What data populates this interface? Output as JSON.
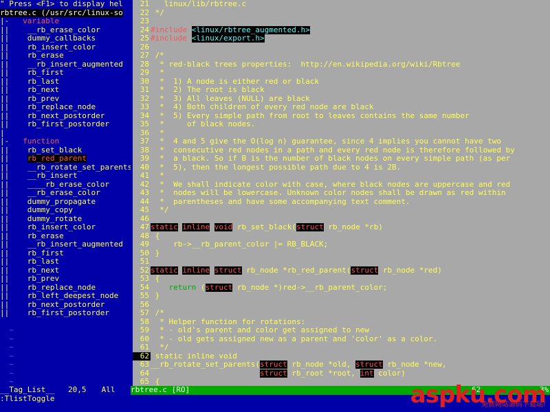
{
  "taglist": {
    "help_line": "\" Press <F1> to display hel",
    "file_header": "rbtree.c (/usr/src/linux-so",
    "groups": [
      {
        "marker": "|-",
        "title": "variable",
        "items": [
          "__rb_erase_color",
          "dummy_callbacks",
          "rb_insert_color",
          "rb_erase",
          "__rb_insert_augmented",
          "rb_first",
          "rb_last",
          "rb_next",
          "rb_prev",
          "rb_replace_node",
          "rb_next_postorder",
          "rb_first_postorder"
        ]
      },
      {
        "marker": "|-",
        "title": "function",
        "items": [
          "rb_set_black",
          "rb_red_parent",
          "__rb_rotate_set_parents",
          "__rb_insert",
          "____rb_erase_color",
          "__rb_erase_color",
          "dummy_propagate",
          "dummy_copy",
          "dummy_rotate",
          "rb_insert_color",
          "rb_erase",
          "__rb_insert_augmented",
          "rb_first",
          "rb_last",
          "rb_next",
          "rb_prev",
          "rb_replace_node",
          "rb_left_deepest_node",
          "rb_next_postorder",
          "rb_first_postorder"
        ]
      }
    ],
    "selected_item": "rb_red_parent",
    "tree_pipe": "||",
    "tilde": "~"
  },
  "editor": {
    "lines": [
      {
        "n": "21",
        "t": "  linux/lib/rbtree.c"
      },
      {
        "n": "22",
        "t": "*/"
      },
      {
        "n": "23",
        "t": ""
      },
      {
        "n": "24",
        "pp": "#include",
        "inc": "<linux/rbtree_augmented.h>"
      },
      {
        "n": "25",
        "pp": "#include",
        "inc": "<linux/export.h>"
      },
      {
        "n": "26",
        "t": ""
      },
      {
        "n": "27",
        "t": "/*"
      },
      {
        "n": "28",
        "t": " * red-black trees properties:  http://en.wikipedia.org/wiki/Rbtree"
      },
      {
        "n": "29",
        "t": " *"
      },
      {
        "n": "30",
        "t": " *  1) A node is either red or black"
      },
      {
        "n": "31",
        "t": " *  2) The root is black"
      },
      {
        "n": "32",
        "t": " *  3) All leaves (NULL) are black"
      },
      {
        "n": "33",
        "t": " *  4) Both children of every red node are black"
      },
      {
        "n": "34",
        "t": " *  5) Every simple path from root to leaves contains the same number"
      },
      {
        "n": "35",
        "t": " *     of black nodes."
      },
      {
        "n": "36",
        "t": " *"
      },
      {
        "n": "37",
        "t": " *  4 and 5 give the O(log n) guarantee, since 4 implies you cannot have two"
      },
      {
        "n": "38",
        "t": " *  consecutive red nodes in a path and every red node is therefore followed by"
      },
      {
        "n": "39",
        "t": " *  a black. So if B is the number of black nodes on every simple path (as per"
      },
      {
        "n": "40",
        "t": " *  5), then the longest possible path due to 4 is 2B."
      },
      {
        "n": "41",
        "t": " *"
      },
      {
        "n": "42",
        "t": " *  We shall indicate color with case, where black nodes are uppercase and red"
      },
      {
        "n": "43",
        "t": " *  nodes will be lowercase. Unknown color nodes shall be drawn as red within"
      },
      {
        "n": "44",
        "t": " *  parentheses and have some accompanying text comment."
      },
      {
        "n": "45",
        "t": " */"
      },
      {
        "n": "46",
        "t": ""
      },
      {
        "n": "47",
        "parts": [
          [
            "kw",
            "static"
          ],
          [
            "t",
            " "
          ],
          [
            "kw",
            "inline"
          ],
          [
            "t",
            " "
          ],
          [
            "kw",
            "void"
          ],
          [
            "t",
            " rb_set_black("
          ],
          [
            "kw",
            "struct"
          ],
          [
            "t",
            " rb_node *rb)"
          ]
        ]
      },
      {
        "n": "48",
        "t": "{"
      },
      {
        "n": "49",
        "t": "    rb->__rb_parent_color |= RB_BLACK;"
      },
      {
        "n": "50",
        "t": "}"
      },
      {
        "n": "51",
        "t": ""
      },
      {
        "n": "52",
        "parts": [
          [
            "kw",
            "static"
          ],
          [
            "t",
            " "
          ],
          [
            "kw",
            "inline"
          ],
          [
            "t",
            " "
          ],
          [
            "kw",
            "struct"
          ],
          [
            "t",
            " rb_node *rb_red_parent("
          ],
          [
            "kw",
            "struct"
          ],
          [
            "t",
            " rb_node *red)"
          ]
        ]
      },
      {
        "n": "53",
        "t": "{"
      },
      {
        "n": "54",
        "parts": [
          [
            "t",
            "    "
          ],
          [
            "kwg",
            "return"
          ],
          [
            "t",
            " ("
          ],
          [
            "kw",
            "struct"
          ],
          [
            "t",
            " rb_node *)red->__rb_parent_color;"
          ]
        ]
      },
      {
        "n": "55",
        "t": "}"
      },
      {
        "n": "56",
        "t": ""
      },
      {
        "n": "57",
        "t": "/*"
      },
      {
        "n": "58",
        "t": " * Helper function for rotations:"
      },
      {
        "n": "59",
        "t": " * - old's parent and color get assigned to new"
      },
      {
        "n": "60",
        "t": " * - old gets assigned new as a parent and 'color' as a color."
      },
      {
        "n": "61",
        "t": " */"
      },
      {
        "n": "62",
        "cur": true,
        "t": "static inline void"
      },
      {
        "n": "63",
        "parts": [
          [
            "t",
            "__rb_rotate_set_parents("
          ],
          [
            "kw",
            "struct"
          ],
          [
            "t",
            " rb_node *old, "
          ],
          [
            "kw",
            "struct"
          ],
          [
            "t",
            " rb_node *new,"
          ]
        ]
      },
      {
        "n": "64",
        "parts": [
          [
            "t",
            "                        "
          ],
          [
            "kw",
            "struct"
          ],
          [
            "t",
            " rb_root *root, "
          ],
          [
            "kw",
            "int"
          ],
          [
            "t",
            " color)"
          ]
        ]
      },
      {
        "n": "65",
        "t": "{"
      }
    ]
  },
  "status": {
    "left_name": "__Tag_List__",
    "left_pos": "20,5",
    "left_scroll": "All",
    "right_file": "rbtree.c [RO]",
    "right_pos": "62",
    "right_scroll": "3%"
  },
  "cmdline": ":TlistToggle",
  "watermark": {
    "brand": "aspku.com",
    "tagline": "免费网站源码下载站!"
  },
  "colors": {
    "background": "#0000a8",
    "editor_bg": "#a8a8a8",
    "text": "#ffff54",
    "keyword": "#fc5454",
    "statusbar": "#00a800"
  }
}
